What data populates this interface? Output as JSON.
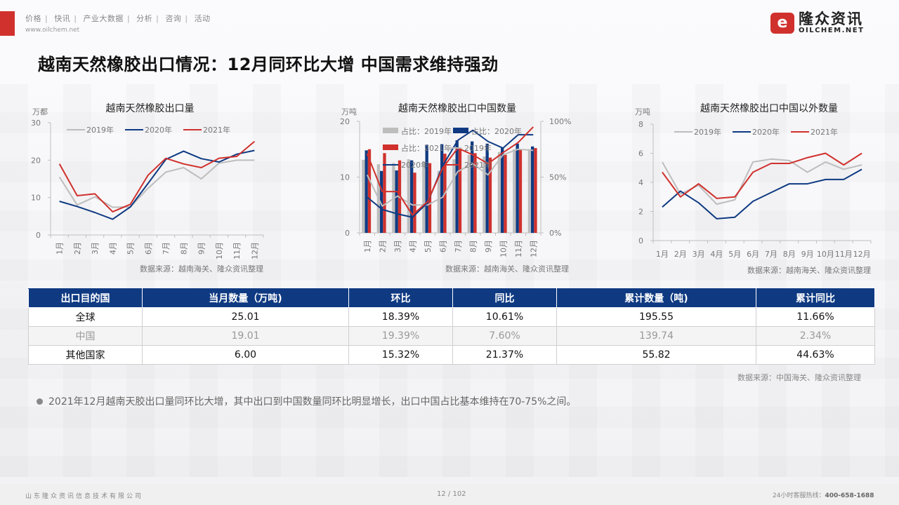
{
  "header": {
    "nav_items": [
      "价格",
      "快讯",
      "产业大数据",
      "分析",
      "咨询",
      "活动"
    ],
    "site_url": "www.oilchem.net",
    "logo": {
      "mark": "e",
      "cn": "隆众资讯",
      "en": "OILCHEM.NET"
    },
    "brand_color": "#d0312d"
  },
  "page_title": "越南天然橡胶出口情况：12月同环比大增 中国需求维持强劲",
  "charts": {
    "colors": {
      "2019": "#bdbdbd",
      "2020": "#0f3a82",
      "2021": "#d0312d"
    }
  },
  "chart_data": [
    {
      "type": "line",
      "title": "越南天然橡胶出口量",
      "ylabel": "万都",
      "xlabel": "",
      "ylim": [
        0,
        30
      ],
      "yticks": [
        0,
        10,
        20,
        30
      ],
      "categories": [
        "1月",
        "2月",
        "3月",
        "4月",
        "5月",
        "6月",
        "7月",
        "8月",
        "9月",
        "10月",
        "11月",
        "12月"
      ],
      "legend_position": "top",
      "source": "数据来源：越南海关、隆众资讯整理",
      "series": [
        {
          "name": "2019年",
          "color": "#bdbdbd",
          "values": [
            15.5,
            8.0,
            10.2,
            7.4,
            7.5,
            12.5,
            16.8,
            18.0,
            15.0,
            19.2,
            20.0,
            20.0
          ]
        },
        {
          "name": "2020年",
          "color": "#0f3a82",
          "values": [
            9.0,
            7.6,
            6.0,
            4.2,
            7.5,
            13.8,
            20.2,
            22.4,
            20.4,
            19.5,
            21.6,
            22.6
          ]
        },
        {
          "name": "2021年",
          "color": "#d0312d",
          "values": [
            19.0,
            10.5,
            11.0,
            6.2,
            8.2,
            16.0,
            20.5,
            19.0,
            18.0,
            20.5,
            21.0,
            25.0
          ]
        }
      ]
    },
    {
      "type": "bar",
      "title": "越南天然橡胶出口中国数量",
      "ylabel": "万吨",
      "xlabel": "",
      "ylim": [
        0,
        20
      ],
      "yticks": [
        0,
        10,
        20
      ],
      "y2lim": [
        0,
        100
      ],
      "y2ticks": [
        "0%",
        "50%",
        "100%"
      ],
      "categories": [
        "1月",
        "2月",
        "3月",
        "4月",
        "5月",
        "6月",
        "7月",
        "8月",
        "9月",
        "10月",
        "11月",
        "12月"
      ],
      "legend_position": "top",
      "source": "数据来源：越南海关、隆众资讯整理",
      "bar_series": [
        {
          "name": "2019年",
          "color": "#bdbdbd",
          "values": [
            13.1,
            12.3,
            12.5,
            13.2,
            12.8,
            11.1,
            13.2,
            14.0,
            13.7,
            14.5,
            15.0,
            15.0
          ]
        },
        {
          "name": "2020年",
          "color": "#0f3a82",
          "values": [
            14.8,
            11.1,
            11.2,
            13.0,
            15.8,
            15.9,
            16.6,
            16.4,
            16.0,
            15.2,
            16.0,
            15.5
          ]
        },
        {
          "name": "2021年",
          "color": "#d0312d",
          "values": [
            15.0,
            14.3,
            13.0,
            10.8,
            12.5,
            14.2,
            15.3,
            14.3,
            13.5,
            14.0,
            15.0,
            15.2
          ]
        }
      ],
      "line_series": [
        {
          "name": "占比：2019年",
          "color": "#bdbdbd",
          "values": [
            52,
            24,
            33,
            25,
            25,
            32,
            55,
            62,
            52,
            70,
            75,
            74
          ]
        },
        {
          "name": "占比：2020年",
          "color": "#0f3a82",
          "values": [
            32,
            21,
            17,
            14,
            27,
            60,
            83,
            92,
            82,
            76,
            88,
            88
          ]
        },
        {
          "name": "占比：2021年",
          "color": "#d0312d",
          "values": [
            71,
            37,
            37,
            16,
            28,
            58,
            76,
            70,
            62,
            72,
            81,
            95
          ]
        }
      ],
      "legend_entries": [
        {
          "label": "占比：2019年",
          "kind": "bar",
          "color": "#bdbdbd"
        },
        {
          "label": "占比：2020年",
          "kind": "bar",
          "color": "#0f3a82"
        },
        {
          "label": "占比：2021年",
          "kind": "bar",
          "color": "#d0312d"
        },
        {
          "label": "2019年",
          "kind": "line",
          "color": "#bdbdbd"
        },
        {
          "label": "2020年",
          "kind": "line",
          "color": "#0f3a82"
        },
        {
          "label": "2021年",
          "kind": "line",
          "color": "#d0312d"
        }
      ]
    },
    {
      "type": "line",
      "title": "越南天然橡胶出口中国以外数量",
      "ylabel": "万吨",
      "xlabel": "",
      "ylim": [
        0,
        8
      ],
      "yticks": [
        0,
        2,
        4,
        6,
        8
      ],
      "categories": [
        "1月",
        "2月",
        "3月",
        "4月",
        "5月",
        "6月",
        "7月",
        "8月",
        "9月",
        "10月",
        "11月",
        "12月"
      ],
      "legend_position": "top",
      "source": "数据来源：越南海关、隆众资讯整理",
      "series": [
        {
          "name": "2019年",
          "color": "#bdbdbd",
          "values": [
            5.4,
            3.2,
            3.8,
            2.5,
            2.8,
            5.4,
            5.6,
            5.5,
            4.7,
            5.4,
            4.9,
            5.2
          ]
        },
        {
          "name": "2020年",
          "color": "#0f3a82",
          "values": [
            2.3,
            3.4,
            2.6,
            1.5,
            1.6,
            2.7,
            3.3,
            3.9,
            3.9,
            4.2,
            4.2,
            4.9
          ]
        },
        {
          "name": "2021年",
          "color": "#d0312d",
          "values": [
            4.7,
            3.0,
            3.9,
            2.9,
            3.0,
            4.7,
            5.3,
            5.3,
            5.7,
            6.0,
            5.2,
            6.0
          ]
        }
      ]
    }
  ],
  "table": {
    "headers": [
      "出口目的国",
      "当月数量（万吨)",
      "环比",
      "同比",
      "累计数量（吨)",
      "累计同比"
    ],
    "rows": [
      [
        "全球",
        "25.01",
        "18.39%",
        "10.61%",
        "195.55",
        "11.66%"
      ],
      [
        "中国",
        "19.01",
        "19.39%",
        "7.60%",
        "139.74",
        "2.34%"
      ],
      [
        "其他国家",
        "6.00",
        "15.32%",
        "21.37%",
        "55.82",
        "44.63%"
      ]
    ],
    "source": "数据来源：中国海关、隆众资讯整理"
  },
  "bullet_text": "2021年12月越南天胶出口量同环比大增，其中出口到中国数量同环比明显增长，出口中国占比基本维持在70-75%之间。",
  "footer": {
    "company": "山东隆众资讯信息技术有限公司",
    "page": "12 / 102",
    "hotline_label": "24小时客服热线：",
    "hotline_number": "400-658-1688"
  }
}
